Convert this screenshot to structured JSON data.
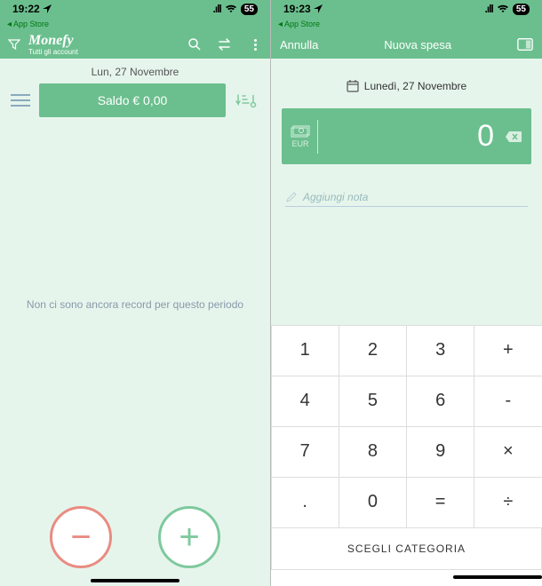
{
  "left": {
    "status": {
      "time": "19:22",
      "battery": "55"
    },
    "breadcrumb": "App Store",
    "app_name": "Monefy",
    "app_sub": "Tutti gli account",
    "date": "Lun, 27 Novembre",
    "balance_label": "Saldo  € 0,00",
    "empty": "Non ci sono ancora record per questo periodo"
  },
  "right": {
    "status": {
      "time": "19:23",
      "battery": "55"
    },
    "breadcrumb": "App Store",
    "cancel": "Annulla",
    "title": "Nuova spesa",
    "date": "Lunedì, 27 Novembre",
    "currency": "EUR",
    "amount": "0",
    "note_placeholder": "Aggiungi nota",
    "keypad": [
      [
        "1",
        "2",
        "3",
        "+"
      ],
      [
        "4",
        "5",
        "6",
        "-"
      ],
      [
        "7",
        "8",
        "9",
        "×"
      ],
      [
        ".",
        "0",
        "=",
        "÷"
      ]
    ],
    "choose_category": "SCEGLI CATEGORIA"
  }
}
